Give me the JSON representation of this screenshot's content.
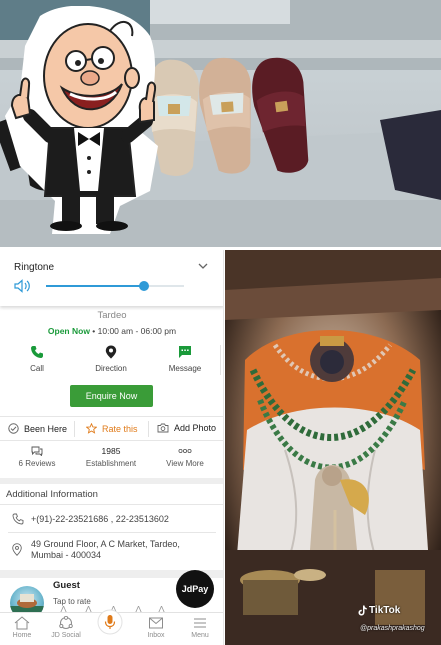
{
  "ringtone": {
    "title": "Ringtone",
    "volume_percent": 71
  },
  "listing": {
    "location": "Tardeo",
    "open_status": "Open Now",
    "hours": " • 10:00 am - 06:00 pm",
    "actions": [
      {
        "label": "Call",
        "icon": "phone-icon"
      },
      {
        "label": "Direction",
        "icon": "location-pin-icon"
      },
      {
        "label": "Message",
        "icon": "message-icon"
      }
    ],
    "enquire_label": "Enquire Now",
    "been_here": "Been Here",
    "rate_this": "Rate this",
    "add_photo": "Add Photo",
    "reviews_label": "6 Reviews",
    "establishment_year": "1985",
    "establishment_label": "Establishment",
    "view_more": "View More",
    "colors": {
      "accent_green": "#3a9c38",
      "open_green": "#1a9a3a",
      "rate_orange": "#e07b1a",
      "slider_blue": "#2f9ad7"
    }
  },
  "additional_info": {
    "title": "Additional Information",
    "phone": "+(91)-22-23521686 , 22-23513602",
    "address_line1": "49 Ground Floor, A C Market, Tardeo,",
    "address_line2": "Mumbai - 400034"
  },
  "guest": {
    "name": "Guest",
    "tap_to_rate": "Tap to rate",
    "rating_stars": 5
  },
  "jdpay_label": "JdPay",
  "bottom_nav": [
    {
      "label": "Home",
      "icon": "home-icon"
    },
    {
      "label": "JD Social",
      "icon": "jd-social-icon"
    },
    {
      "label": "",
      "icon": "mic-icon"
    },
    {
      "label": "Inbox",
      "icon": "inbox-icon"
    },
    {
      "label": "Menu",
      "icon": "menu-icon"
    }
  ],
  "tiktok": {
    "brand": "TikTok",
    "username": "@prakashprakashog"
  }
}
